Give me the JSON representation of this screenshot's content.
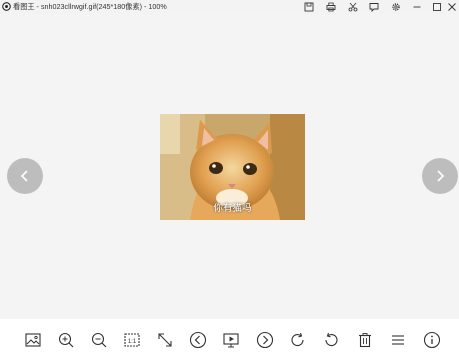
{
  "window": {
    "title": "看图王 - snh023cllrwgif.gif(245*180像素) - 100%",
    "buttons": [
      "save-icon",
      "print-icon",
      "cut-icon",
      "comment-icon",
      "settings-icon",
      "minimize-icon",
      "maximize-icon",
      "close-icon"
    ]
  },
  "image": {
    "caption": "你有猫吗"
  },
  "navigation": {
    "previous": "chevron-left-icon",
    "next": "chevron-right-icon"
  },
  "toolbar": {
    "tools": [
      "image-icon",
      "zoom-in-icon",
      "zoom-out-icon",
      "actual-size-icon",
      "fit-expand-icon",
      "previous-icon",
      "slideshow-icon",
      "next-icon",
      "rotate-clockwise-icon",
      "rotate-counterclockwise-icon",
      "delete-icon",
      "menu-icon",
      "info-icon"
    ]
  },
  "colors": {
    "background": "#f3f3f3",
    "toolbar": "#ffffff",
    "nav_button": "#bdbdbd",
    "icon": "#333333"
  }
}
